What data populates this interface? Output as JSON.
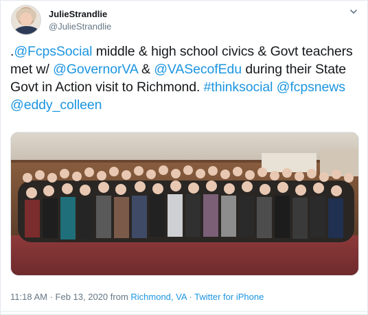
{
  "author": {
    "display_name": "JulieStrandlie",
    "handle": "@JulieStrandlie"
  },
  "tweet": {
    "segments": [
      {
        "type": "text",
        "text": "."
      },
      {
        "type": "mention",
        "text": "@FcpsSocial"
      },
      {
        "type": "text",
        "text": " middle & high school civics & Govt teachers met w/ "
      },
      {
        "type": "mention",
        "text": "@GovernorVA"
      },
      {
        "type": "text",
        "text": " & "
      },
      {
        "type": "mention",
        "text": "@VASecofEdu"
      },
      {
        "type": "text",
        "text": " during their State Govt in Action visit to Richmond. "
      },
      {
        "type": "hashtag",
        "text": "#thinksocial"
      },
      {
        "type": "text",
        "text": " "
      },
      {
        "type": "mention",
        "text": "@fcpsnews"
      },
      {
        "type": "text",
        "text": " "
      },
      {
        "type": "mention",
        "text": "@eddy_colleen"
      }
    ]
  },
  "photo": {
    "description_icon": "group-photo"
  },
  "meta": {
    "time": "11:18 AM",
    "separator1": " · ",
    "date": "Feb 13, 2020",
    "from_label": " from ",
    "location": "Richmond, VA",
    "separator2": " · ",
    "source": "Twitter for iPhone"
  },
  "colors": {
    "link": "#1b95e0",
    "secondary_text": "#657786",
    "primary_text": "#14171a"
  },
  "icons": {
    "menu": "chevron-down-icon"
  }
}
